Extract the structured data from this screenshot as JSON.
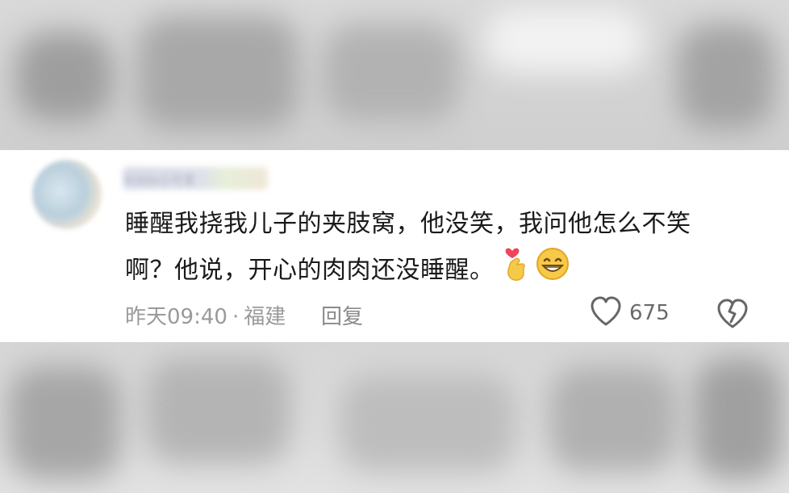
{
  "comment": {
    "username": "kiddo小可爱",
    "content_lines": [
      "睡醒我挠我儿子的夹肢窝，他没笑，我问他怎么不笑",
      "啊？他说，开心的肉肉还没睡醒。"
    ],
    "emojis": [
      "finger-heart-icon",
      "grin-icon"
    ],
    "time": "昨天09:40",
    "separator": "·",
    "location": "福建",
    "reply_label": "回复",
    "like_count": "675"
  },
  "colors": {
    "card_bg": "#ffffff",
    "text": "#1a1a1a",
    "meta": "#9a9a9a",
    "icon_stroke": "#666666",
    "emoji_yellow": "#f7c948",
    "heart_red": "#f0455a"
  }
}
